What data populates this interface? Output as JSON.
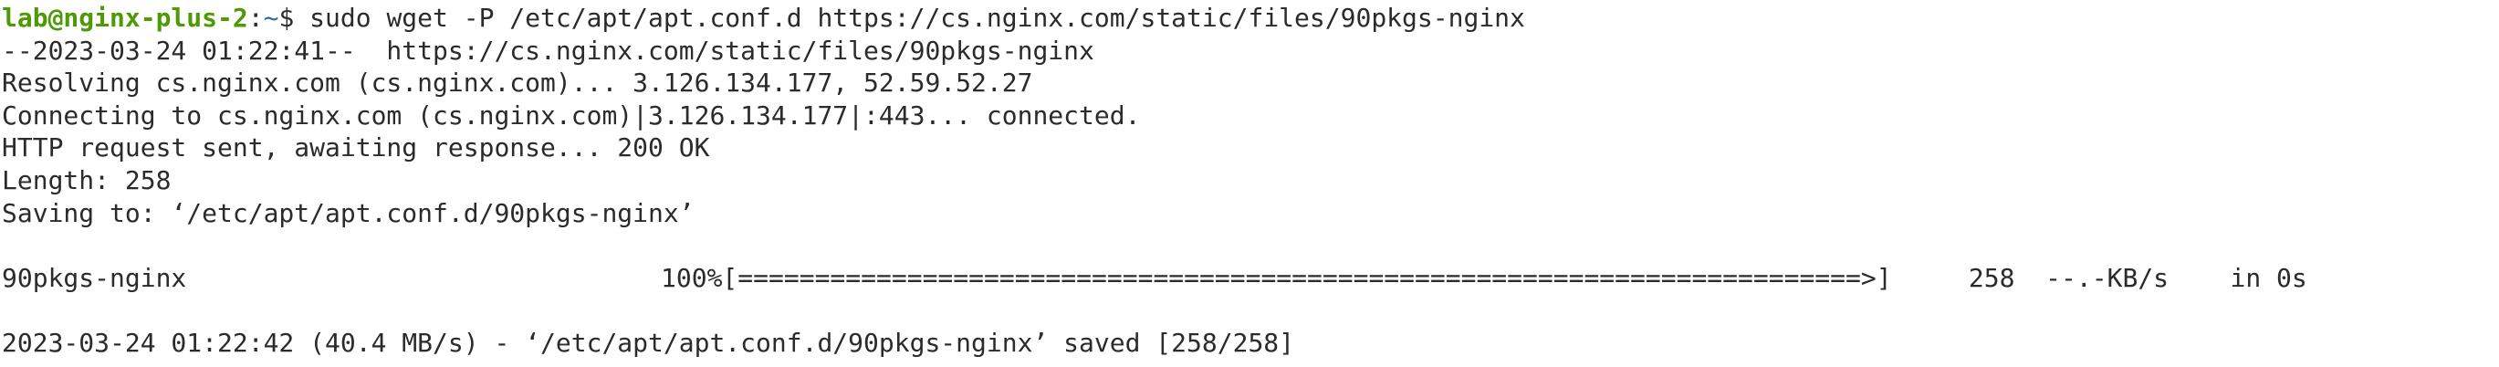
{
  "prompt": {
    "user_host": "lab@nginx-plus-2",
    "colon": ":",
    "path": "~",
    "dollar": "$",
    "command": " sudo wget -P /etc/apt/apt.conf.d https://cs.nginx.com/static/files/90pkgs-nginx"
  },
  "output": {
    "line1": "--2023-03-24 01:22:41--  https://cs.nginx.com/static/files/90pkgs-nginx",
    "line2": "Resolving cs.nginx.com (cs.nginx.com)... 3.126.134.177, 52.59.52.27",
    "line3": "Connecting to cs.nginx.com (cs.nginx.com)|3.126.134.177|:443... connected.",
    "line4": "HTTP request sent, awaiting response... 200 OK",
    "line5": "Length: 258",
    "line6": "Saving to: ‘/etc/apt/apt.conf.d/90pkgs-nginx’",
    "line7": "",
    "progress_file": "90pkgs-nginx",
    "progress_bar": "100%[=========================================================================>]     258  --.-KB/s    in 0s",
    "line9": "",
    "line10": "2023-03-24 01:22:42 (40.4 MB/s) - ‘/etc/apt/apt.conf.d/90pkgs-nginx’ saved [258/258]"
  },
  "colors": {
    "background": "#ffffff",
    "text": "#2b2b2b",
    "user_host": "#4e9a06",
    "path": "#3465a4"
  }
}
